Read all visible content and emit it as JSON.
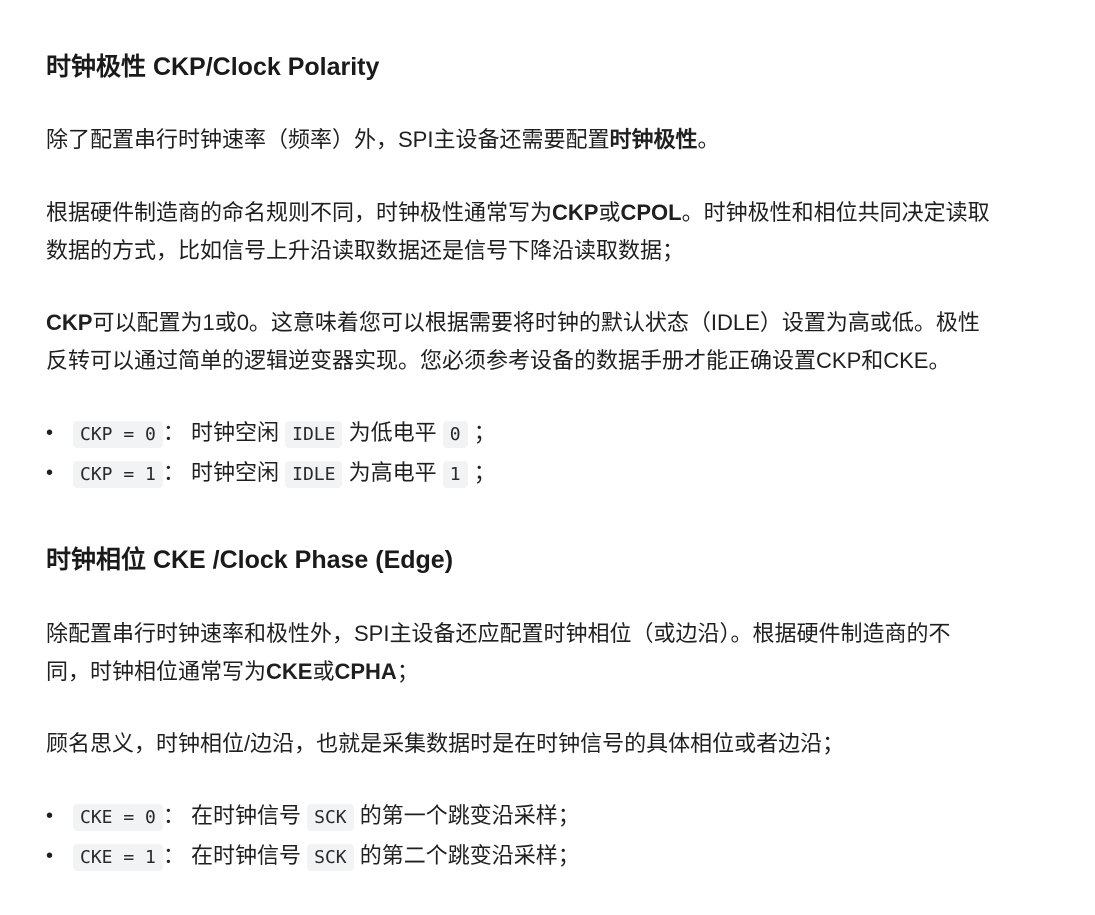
{
  "section1": {
    "heading": "时钟极性 CKP/Clock Polarity",
    "p1": {
      "text": "除了配置串行时钟速率（频率）外，SPI主设备还需要配置",
      "bold": "时钟极性",
      "end": "。"
    },
    "p2": {
      "t1": "根据硬件制造商的命名规则不同，时钟极性通常写为",
      "b1": "CKP",
      "t2": "或",
      "b2": "CPOL",
      "t3": "。时钟极性和相位共同决定读取",
      "t4": "数据的方式，比如信号上升沿读取数据还是信号下降沿读取数据；"
    },
    "p3": {
      "b1": "CKP",
      "t1": "可以配置为1或0。这意味着您可以根据需要将时钟的默认状态（IDLE）设置为高或低。极性",
      "t2": "反转可以通过简单的逻辑逆变器实现。您必须参考设备的数据手册才能正确设置CKP和CKE。"
    },
    "list": [
      {
        "bullet": "•",
        "code1": "CKP = 0",
        "t1": "： 时钟空闲",
        "code2": "IDLE",
        "t2": "为低电平",
        "code3": "0",
        "t3": "；"
      },
      {
        "bullet": "•",
        "code1": "CKP = 1",
        "t1": "： 时钟空闲",
        "code2": "IDLE",
        "t2": "为高电平",
        "code3": "1",
        "t3": "；"
      }
    ]
  },
  "section2": {
    "heading": "时钟相位 CKE /Clock Phase (Edge)",
    "p4": {
      "t1": "除配置串行时钟速率和极性外，SPI主设备还应配置时钟相位（或边沿）。根据硬件制造商的不",
      "t2": "同，时钟相位通常写为",
      "b1": "CKE",
      "t3": "或",
      "b2": "CPHA",
      "t4": "；"
    },
    "p5": "顾名思义，时钟相位/边沿，也就是采集数据时是在时钟信号的具体相位或者边沿；",
    "list": [
      {
        "bullet": "•",
        "code1": "CKE = 0",
        "t1": "： 在时钟信号",
        "code2": "SCK",
        "t2": "的第一个跳变沿采样；"
      },
      {
        "bullet": "•",
        "code1": "CKE = 1",
        "t1": "： 在时钟信号",
        "code2": "SCK",
        "t2": "的第二个跳变沿采样；"
      }
    ]
  }
}
